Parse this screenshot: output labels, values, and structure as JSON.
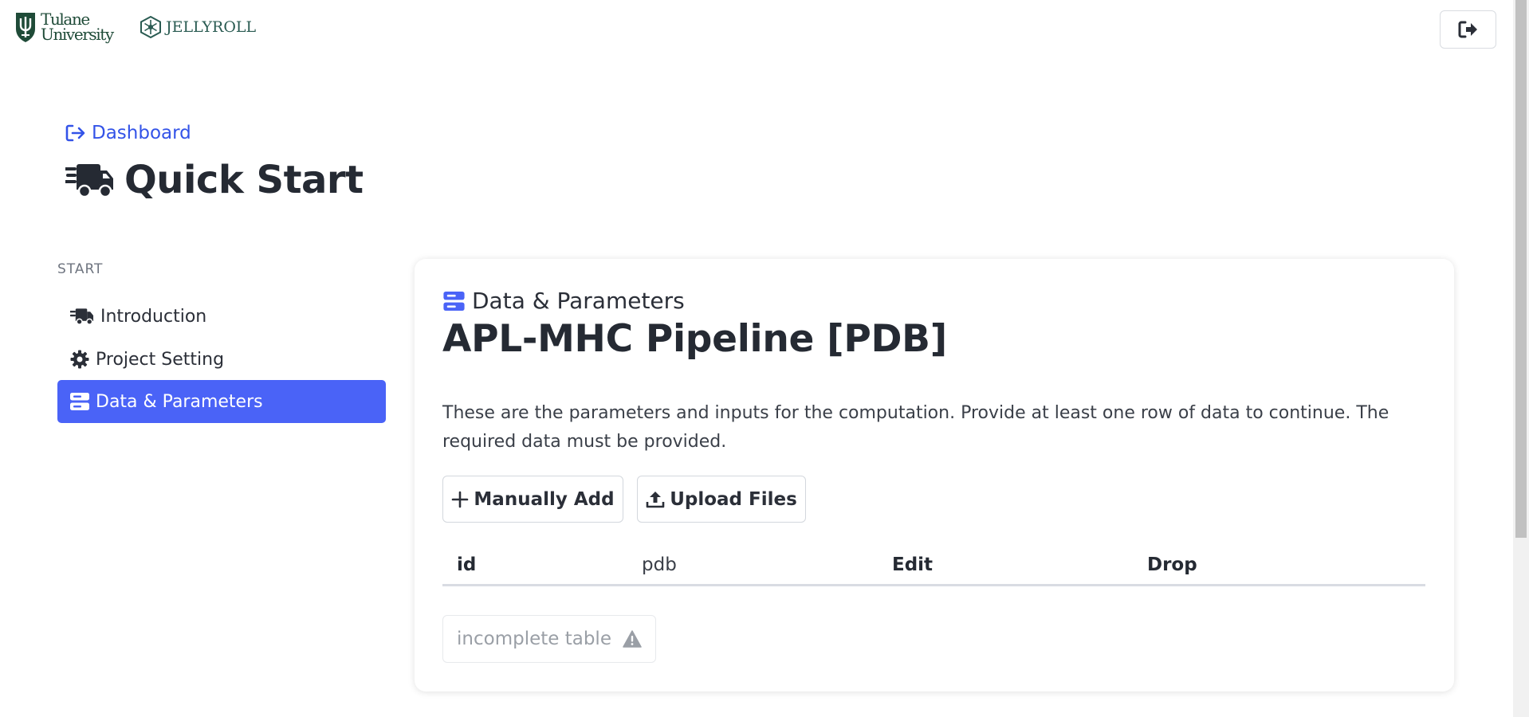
{
  "header": {
    "tulane_logo": {
      "line1": "Tulane",
      "line2": "University",
      "icon": "tulane-shield-icon"
    },
    "jellyroll_logo": {
      "text": "JELLYROLL",
      "icon": "jellyroll-hex-icon"
    },
    "logout": {
      "icon": "sign-out-icon"
    }
  },
  "page": {
    "back_link": {
      "label": "Dashboard",
      "icon": "arrow-right-from-bracket-icon"
    },
    "title": "Quick Start",
    "title_icon": "truck-fast-icon"
  },
  "sidebar": {
    "section_label": "START",
    "items": [
      {
        "label": "Introduction",
        "icon": "truck-fast-icon",
        "active": false
      },
      {
        "label": "Project Setting",
        "icon": "gear-icon",
        "active": false
      },
      {
        "label": "Data & Parameters",
        "icon": "server-icon",
        "active": true
      }
    ]
  },
  "card": {
    "eyebrow": "Data & Parameters",
    "eyebrow_icon": "server-icon",
    "title": "APL-MHC Pipeline [PDB]",
    "description": "These are the parameters and inputs for the computation. Provide at least one row of data to continue. The required data must be provided.",
    "buttons": {
      "add_label": "Manually Add",
      "add_icon": "plus-icon",
      "upload_label": "Upload Files",
      "upload_icon": "upload-icon"
    },
    "table": {
      "columns": [
        "id",
        "pdb",
        "Edit",
        "Drop"
      ],
      "rows": []
    },
    "status": {
      "label": "incomplete table",
      "icon": "warning-triangle-icon"
    }
  },
  "colors": {
    "accent": "#4a63f7",
    "link": "#3353e8",
    "text": "#2b2f38",
    "muted": "#9a9fa6",
    "tulane_green": "#1f4b38"
  }
}
